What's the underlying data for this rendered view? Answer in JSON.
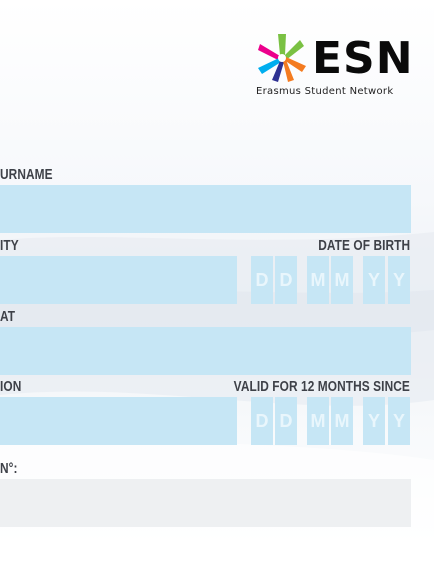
{
  "logo": {
    "text": "ESN",
    "subtitle": "Erasmus Student Network",
    "colors": [
      "#ec008c",
      "#7ac143",
      "#00aeef",
      "#f47b20",
      "#2e3192"
    ]
  },
  "form": {
    "surname_label": "URNAME",
    "nationality_label": "ITY",
    "dob_label": "DATE OF BIRTH",
    "field_three_label": "AT",
    "field_four_label": "ION",
    "valid_label": "VALID FOR 12 MONTHS SINCE",
    "number_label": "N°:",
    "date_placeholders": [
      "D",
      "D",
      "M",
      "M",
      "Y",
      "Y"
    ]
  },
  "colors": {
    "field": "#c6e6f5",
    "field_grey": "#eef0f2",
    "label": "#3e4148"
  }
}
